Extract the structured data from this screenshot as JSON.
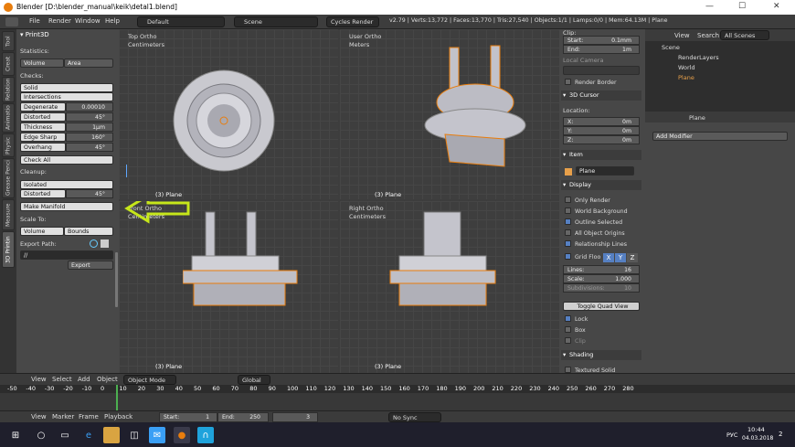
{
  "titlebar": {
    "title": "Blender [D:\\blender_manual\\keik\\detal1.blend]",
    "min": "—",
    "max": "☐",
    "close": "✕"
  },
  "menubar": {
    "items": [
      "File",
      "Render",
      "Window",
      "Help"
    ],
    "layout": "Default",
    "scene": "Scene",
    "engine": "Cycles Render",
    "logo": "",
    "stats": "v2.79 | Verts:13,772 | Faces:13,770 | Tris:27,540 | Objects:1/1 | Lamps:0/0 | Mem:64.13M | Plane"
  },
  "tabs": [
    "Tool",
    "Creat",
    "Relation",
    "Animatio",
    "Physic",
    "Grease Penci",
    "Measure",
    "3D Printin"
  ],
  "print3d": {
    "header": "Print3D",
    "statistics": "Statistics:",
    "volume": "Volume",
    "area": "Area",
    "checks": "Checks:",
    "solid": "Solid",
    "intersections": "Intersections",
    "rows": [
      {
        "label": "Degenerate",
        "value": "0.00010"
      },
      {
        "label": "Distorted",
        "value": "45°"
      },
      {
        "label": "Thickness",
        "value": "1µm"
      },
      {
        "label": "Edge Sharp",
        "value": "160°"
      },
      {
        "label": "Overhang",
        "value": "45°"
      }
    ],
    "check_all": "Check All",
    "cleanup": "Cleanup:",
    "isolated": "Isolated",
    "distorted": "Distorted",
    "distorted_value": "45°",
    "make_manifold": "Make Manifold",
    "scale_to": "Scale To:",
    "bounds": "Bounds",
    "export_path": "Export Path:",
    "export_value": "//",
    "export_btn": "Export"
  },
  "viewports": [
    {
      "name": "Top Ortho",
      "unit": "Centimeters",
      "obj": "(3) Plane"
    },
    {
      "name": "User Ortho",
      "unit": "Meters",
      "obj": "(3) Plane"
    },
    {
      "name": "Front Ortho",
      "unit": "Centimeters",
      "obj": "(3) Plane"
    },
    {
      "name": "Right Ortho",
      "unit": "Centimeters",
      "obj": "(3) Plane"
    }
  ],
  "npanel": {
    "clip": "Clip:",
    "start_label": "Start:",
    "start": "0.1mm",
    "end_label": "End:",
    "end": "1m",
    "local_camera": "Local Camera",
    "render_border": "Render Border",
    "cursor": "3D Cursor",
    "location": "Location:",
    "x": "X:",
    "y": "Y:",
    "z": "Z:",
    "zero": "0m",
    "item": "Item",
    "item_name": "Plane",
    "display": "Display",
    "display_opts": [
      {
        "label": "Only Render",
        "on": false
      },
      {
        "label": "World Background",
        "on": false
      },
      {
        "label": "Outline Selected",
        "on": true
      },
      {
        "label": "All Object Origins",
        "on": false
      },
      {
        "label": "Relationship Lines",
        "on": true
      }
    ],
    "grid_floor": "Grid Floo",
    "axes": [
      "X",
      "Y",
      "Z"
    ],
    "lines_label": "Lines:",
    "lines": "16",
    "scale_label": "Scale:",
    "scale": "1.000",
    "subdiv_label": "Subdivisions:",
    "subdiv": "10",
    "toggle_quad": "Toggle Quad View",
    "lock": "Lock",
    "box": "Box",
    "clip2": "Clip",
    "shading": "Shading",
    "textured_solid": "Textured Solid"
  },
  "outliner": {
    "view": "View",
    "search": "Search",
    "filter": "All Scenes",
    "items": [
      "Scene",
      "RenderLayers",
      "World",
      "Plane"
    ]
  },
  "props": {
    "object": "Plane",
    "add_modifier": "Add Modifier"
  },
  "vpheader": {
    "items": [
      "View",
      "Select",
      "Add",
      "Object"
    ],
    "mode": "Object Mode",
    "pivot": "Global"
  },
  "timeline": {
    "ticks": [
      "-50",
      "-40",
      "-30",
      "-20",
      "-10",
      "0",
      "10",
      "20",
      "30",
      "40",
      "50",
      "60",
      "70",
      "80",
      "90",
      "100",
      "110",
      "120",
      "130",
      "140",
      "150",
      "160",
      "170",
      "180",
      "190",
      "200",
      "210",
      "220",
      "230",
      "240",
      "250",
      "260",
      "270",
      "280"
    ],
    "menu": [
      "View",
      "Marker",
      "Frame",
      "Playback"
    ],
    "start_label": "Start:",
    "start": "1",
    "end_label": "End:",
    "end": "250",
    "current": "3",
    "sync": "No Sync"
  },
  "taskbar": {
    "time": "10:44",
    "date": "04.03.2018",
    "lang": "РУС",
    "notif": "2"
  }
}
